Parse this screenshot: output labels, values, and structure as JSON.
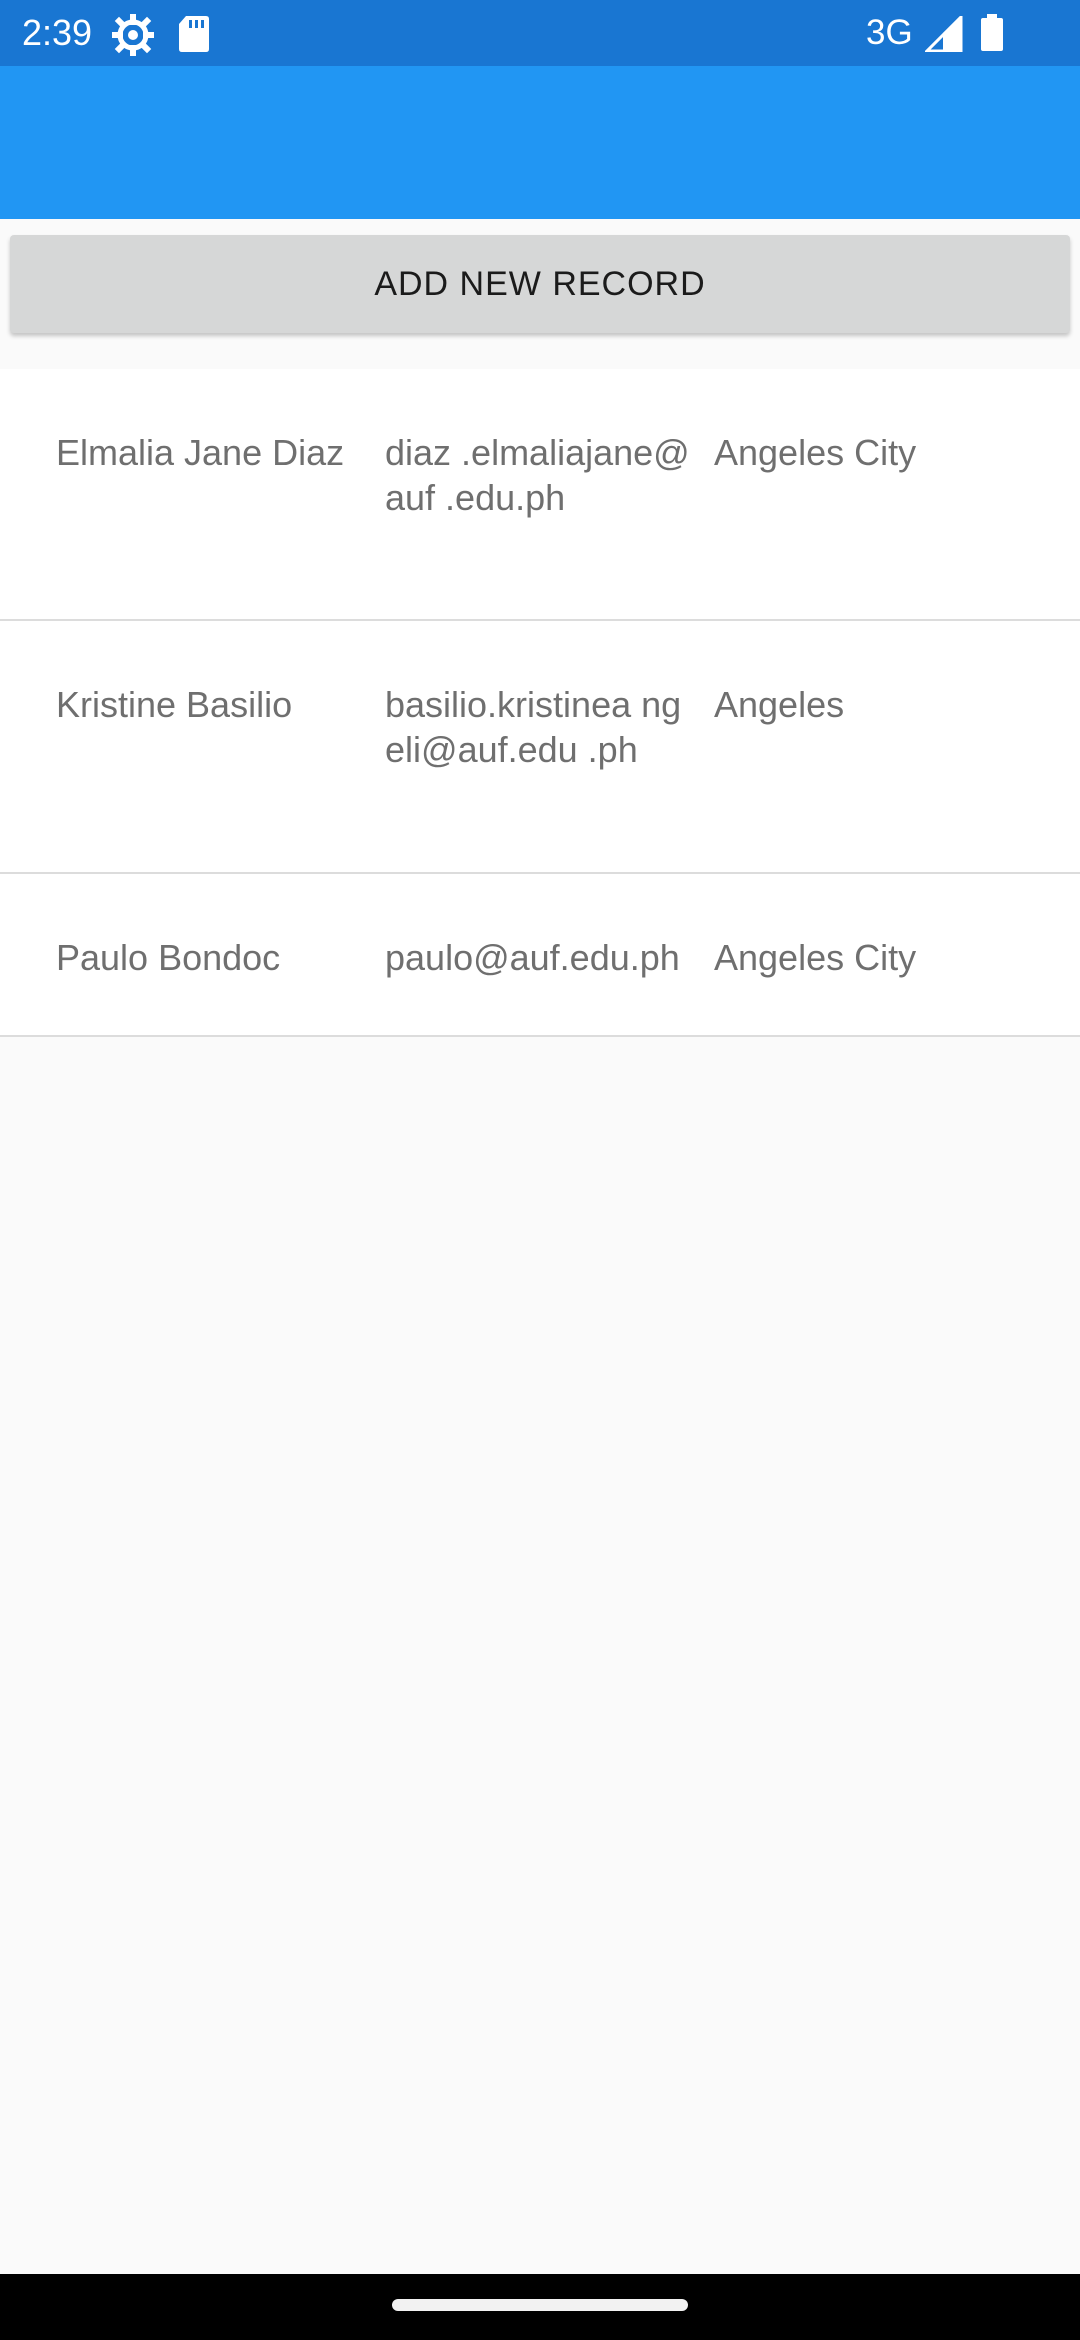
{
  "status_bar": {
    "time": "2:39",
    "icons": [
      "settings-gear-icon",
      "sd-card-icon",
      "signal-icon",
      "battery-icon"
    ],
    "network": "3G",
    "background_color": "#1976d2"
  },
  "app_bar": {
    "background_color": "#2196f3"
  },
  "actions": {
    "add_record_label": "ADD NEW RECORD"
  },
  "records": [
    {
      "name": "Elmalia Jane Diaz",
      "email": "diaz .elmaliajane@auf .edu.ph",
      "city": "Angeles City"
    },
    {
      "name": "Kristine Basilio",
      "email": "basilio.kristinea ngeli@auf.edu .ph",
      "city": "Angeles"
    },
    {
      "name": "Paulo Bondoc",
      "email": "paulo@auf.edu.ph",
      "city": "Angeles City"
    }
  ]
}
